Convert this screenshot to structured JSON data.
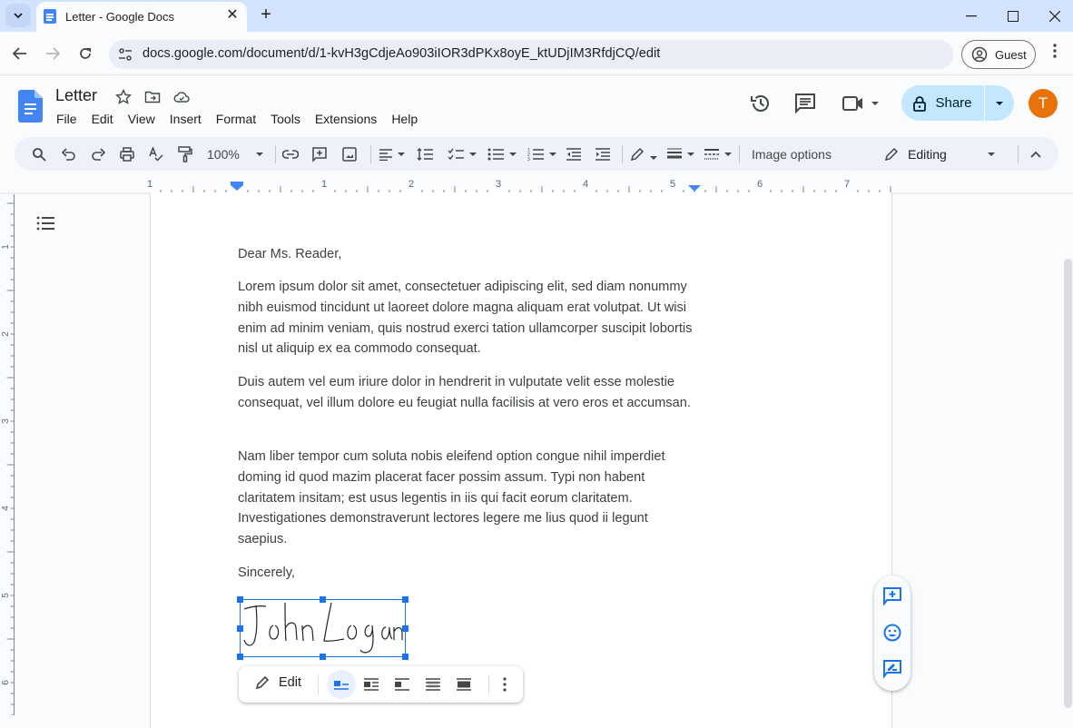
{
  "browser": {
    "tab_title": "Letter - Google Docs",
    "new_tab_label": "+",
    "url": "docs.google.com/document/d/1-kvH3gCdjeAo903iIOR3dPKx8oyE_ktUDjIM3RfdjCQ/edit",
    "profile_label": "Guest",
    "window_controls": [
      "minimize",
      "maximize",
      "close"
    ]
  },
  "docs": {
    "title": "Letter",
    "header_icons": [
      "star-icon",
      "move-to-folder-icon",
      "cloud-saved-icon"
    ],
    "menu": [
      "File",
      "Edit",
      "View",
      "Insert",
      "Format",
      "Tools",
      "Extensions",
      "Help"
    ],
    "share_label": "Share",
    "avatar_initial": "T",
    "accent_color": "#1a73e8",
    "share_bg": "#c2e7ff",
    "avatar_color": "#e8710a"
  },
  "toolbar": {
    "zoom": "100%",
    "image_options_label": "Image options",
    "mode_label": "Editing",
    "buttons": [
      "search",
      "undo",
      "redo",
      "print",
      "spellcheck",
      "paint-format",
      "zoom",
      "link",
      "comment",
      "image",
      "align",
      "line-spacing",
      "checklist",
      "bulleted-list",
      "numbered-list",
      "decrease-indent",
      "increase-indent",
      "border-color",
      "border-weight",
      "border-dash",
      "image-options",
      "editing-mode",
      "collapse"
    ]
  },
  "ruler": {
    "h_labels": [
      "1",
      "1",
      "2",
      "3",
      "4",
      "5",
      "6",
      "7"
    ],
    "v_labels": [
      "1",
      "2",
      "3",
      "4",
      "5",
      "6"
    ]
  },
  "document": {
    "salutation": "Dear Ms. Reader,",
    "paragraphs": [
      "Lorem ipsum dolor sit amet, consectetuer adipiscing elit, sed diam nonummy nibh euismod tincidunt ut laoreet dolore magna aliquam erat volutpat. Ut wisi enim ad minim veniam, quis nostrud exerci tation ullamcorper suscipit lobortis nisl ut aliquip ex ea commodo consequat.",
      "Duis autem vel eum iriure dolor in hendrerit in vulputate velit esse molestie consequat, vel illum dolore eu feugiat nulla facilisis at vero eros et accumsan.",
      "Nam liber tempor cum soluta nobis eleifend option congue nihil imperdiet doming id quod mazim placerat facer possim assum. Typi non habent claritatem insitam; est usus legentis in iis qui facit eorum claritatem. Investigationes demonstraverunt lectores legere me lius quod ii legunt saepius."
    ],
    "closing": "Sincerely,",
    "signature_text": "John Logan"
  },
  "image_toolbar": {
    "edit_label": "Edit",
    "wrap_options": [
      "in-line",
      "wrap-text",
      "break-text",
      "behind-text",
      "in-front-of-text"
    ],
    "selected_wrap": "in-line"
  },
  "side_actions": [
    "add-comment",
    "add-emoji-reaction",
    "suggest-edits"
  ]
}
